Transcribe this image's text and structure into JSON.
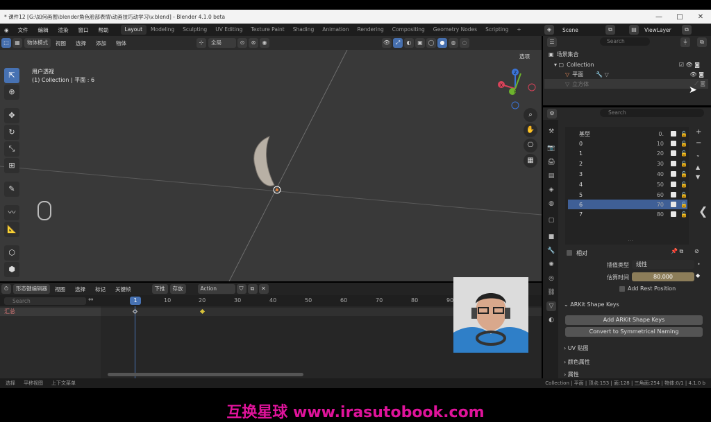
{
  "window": {
    "title": "* 课件12 [G:\\如何画图\\blender角色脸部表情\\动画技巧动学习\\v.blend] - Blender 4.1.0 beta",
    "minimize": "—",
    "maximize": "□",
    "close": "✕"
  },
  "menus": [
    "文件",
    "编辑",
    "渲染",
    "窗口",
    "帮助"
  ],
  "workspaces": [
    "Layout",
    "Modeling",
    "Sculpting",
    "UV Editing",
    "Texture Paint",
    "Shading",
    "Animation",
    "Rendering",
    "Compositing",
    "Geometry Nodes",
    "Scripting"
  ],
  "active_workspace": "Layout",
  "scene": {
    "label": "Scene",
    "view_layer": "ViewLayer"
  },
  "viewport": {
    "mode": "物体模式",
    "menus": [
      "视图",
      "选择",
      "添加",
      "物体"
    ],
    "orientation": "全局",
    "view_name": "用户透视",
    "collection_info": "(1) Collection | 平面 : 6",
    "options_label": "选项",
    "gizmo": {
      "x": "X",
      "y": "Y",
      "z": "Z"
    }
  },
  "outliner": {
    "search_placeholder": "Search",
    "root": "场景集合",
    "collection": "Collection",
    "items": [
      "平面",
      "立方体"
    ]
  },
  "properties": {
    "search_placeholder": "Search",
    "shape_keys": [
      {
        "name": "基型",
        "value": "0."
      },
      {
        "name": "0",
        "value": "10"
      },
      {
        "name": "1",
        "value": "20"
      },
      {
        "name": "2",
        "value": "30"
      },
      {
        "name": "3",
        "value": "40"
      },
      {
        "name": "4",
        "value": "50"
      },
      {
        "name": "5",
        "value": "60"
      },
      {
        "name": "6",
        "value": "70"
      },
      {
        "name": "7",
        "value": "80"
      }
    ],
    "selected_index": 7,
    "relative_label": "相对",
    "interp_label": "插值类型",
    "interp_value": "线性",
    "eval_time_label": "估算时间",
    "eval_time_value": "80.000",
    "add_rest_label": "Add Rest Position",
    "arkit_section": "ARKit Shape Keys",
    "add_arkit_button": "Add ARKit Shape Keys",
    "convert_button": "Convert to Symmetrical Naming",
    "uv_section": "UV 贴图",
    "color_section": "颜色属性",
    "attr_section": "属性"
  },
  "timeline": {
    "editor": "形态键编辑器",
    "menus": [
      "视图",
      "选择",
      "标记",
      "关键帧"
    ],
    "push_down": "下推",
    "stash": "存放",
    "action": "Action",
    "search_placeholder": "Search",
    "channel": "汇总",
    "current_frame": "1",
    "frame_labels": [
      "10",
      "20",
      "30",
      "40",
      "50",
      "60",
      "70",
      "80",
      "90"
    ]
  },
  "statusbar": {
    "left": [
      "选择",
      "平移视图",
      "上下文菜单"
    ],
    "right": "Collection | 平面 | 顶点:153 | 面:128 | 三角面:254 | 物体:0/1 | 4.1.0 b"
  },
  "banner": "互换星球 www.irasutobook.com",
  "colors": {
    "accent": "#4772b3",
    "banner": "#e0139b"
  }
}
